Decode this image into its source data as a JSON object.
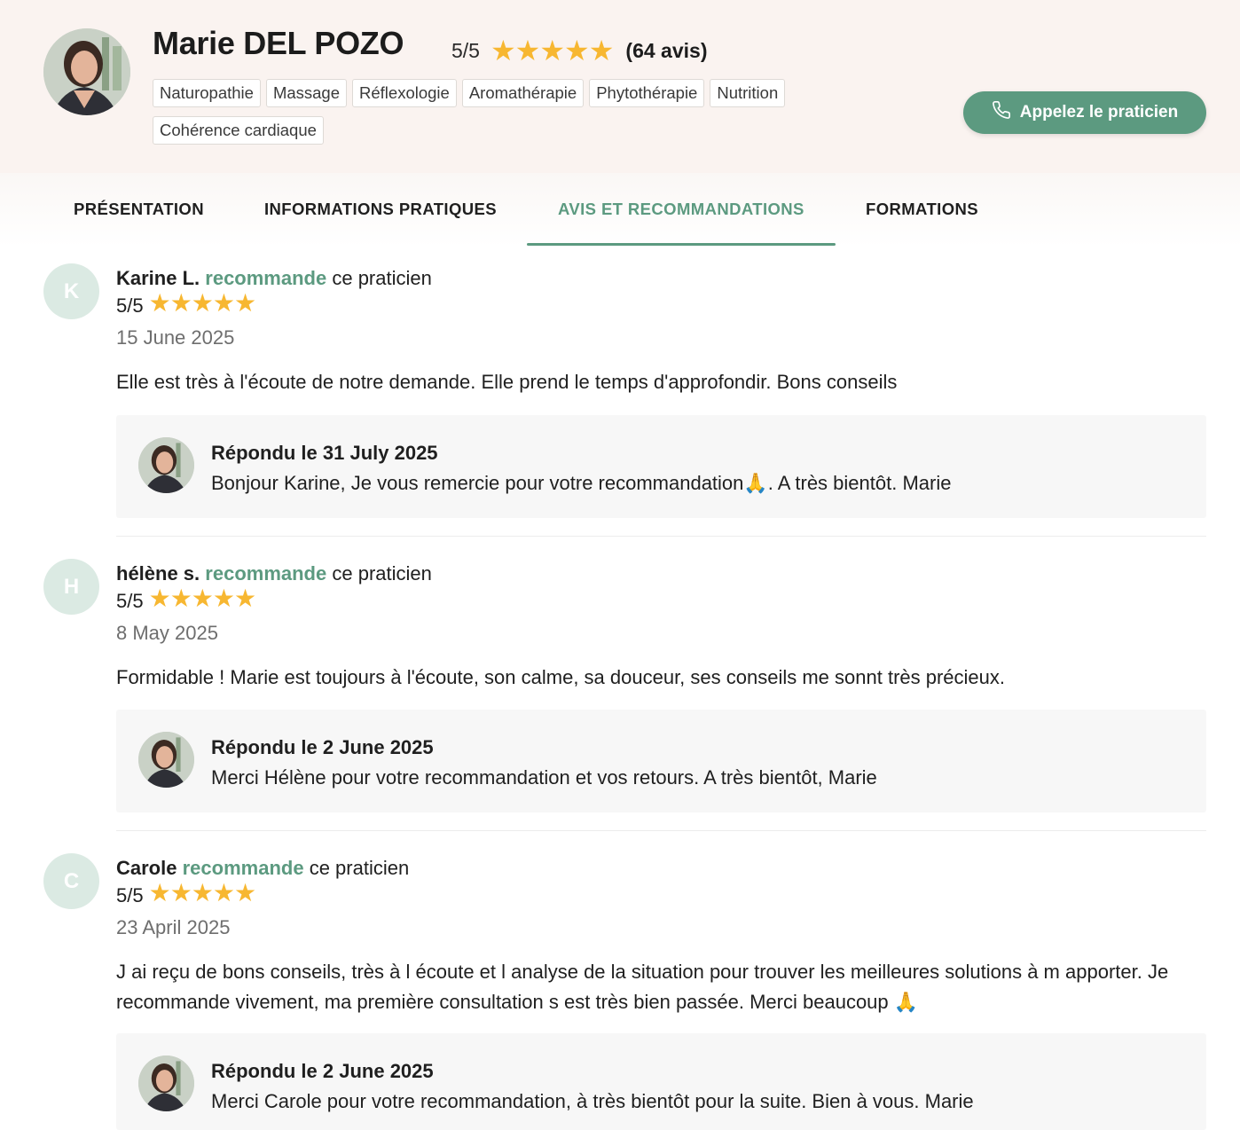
{
  "practitioner": {
    "name": "Marie DEL POZO",
    "rating": "5/5",
    "stars": "★★★★★",
    "review_count": "(64 avis)",
    "tags": [
      "Naturopathie",
      "Massage",
      "Réflexologie",
      "Aromathérapie",
      "Phytothérapie",
      "Nutrition",
      "Cohérence cardiaque"
    ],
    "call_label": "Appelez le praticien"
  },
  "tabs": [
    {
      "label": "PRÉSENTATION",
      "active": false
    },
    {
      "label": "INFORMATIONS PRATIQUES",
      "active": false
    },
    {
      "label": "AVIS ET RECOMMANDATIONS",
      "active": true
    },
    {
      "label": "FORMATIONS",
      "active": false
    }
  ],
  "colors": {
    "accent": "#5c9a80",
    "star": "#f7b731",
    "header_bg": "#faf3f0",
    "reply_bg": "#f7f7f7",
    "avatar_bg": "#dbeae3"
  },
  "reviews": [
    {
      "initial": "K",
      "author": "Karine L.",
      "recommends": "recommande",
      "suffix": "ce praticien",
      "rating": "5/5",
      "stars": "★★★★★",
      "date": "15 June 2025",
      "text": "Elle est très à l'écoute de notre demande. Elle prend le temps d'approfondir. Bons conseils",
      "reply_title": "Répondu le 31 July 2025",
      "reply_text": "Bonjour Karine, Je vous remercie pour votre recommandation🙏. A très bientôt. Marie"
    },
    {
      "initial": "H",
      "author": "hélène s.",
      "recommends": "recommande",
      "suffix": "ce praticien",
      "rating": "5/5",
      "stars": "★★★★★",
      "date": "8 May 2025",
      "text": "Formidable ! Marie est toujours à l'écoute, son calme, sa douceur, ses conseils me sonnt très précieux.",
      "reply_title": "Répondu le 2 June 2025",
      "reply_text": "Merci Hélène pour votre recommandation et vos retours. A très bientôt, Marie"
    },
    {
      "initial": "C",
      "author": "Carole",
      "recommends": "recommande",
      "suffix": "ce praticien",
      "rating": "5/5",
      "stars": "★★★★★",
      "date": "23 April 2025",
      "text": "J ai reçu de bons conseils, très à l écoute et l analyse de la situation pour trouver les meilleures solutions à m apporter. Je recommande vivement, ma première consultation s est très bien passée. Merci beaucoup 🙏",
      "reply_title": "Répondu le 2 June 2025",
      "reply_text": "Merci Carole pour votre recommandation, à très bientôt pour la suite. Bien à vous. Marie"
    }
  ]
}
